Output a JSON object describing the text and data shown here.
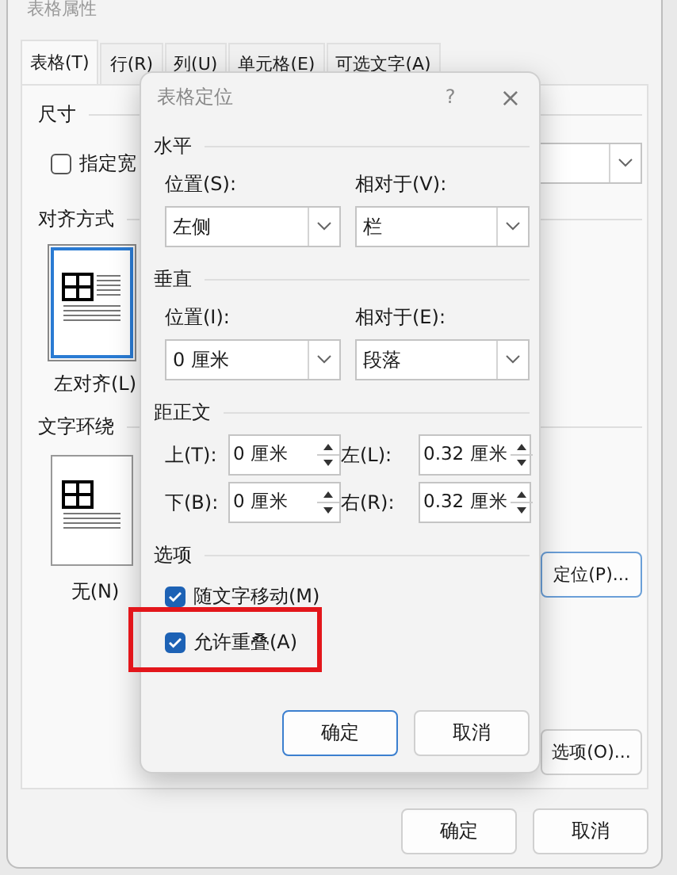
{
  "outer_dialog": {
    "title": "表格属性",
    "tabs": [
      {
        "label": "表格(T)",
        "selected": true
      },
      {
        "label": "行(R)",
        "selected": false
      },
      {
        "label": "列(U)",
        "selected": false
      },
      {
        "label": "单元格(E)",
        "selected": false
      },
      {
        "label": "可选文字(A)",
        "selected": false
      }
    ],
    "size_section": {
      "heading": "尺寸",
      "width_checkbox": {
        "label": "指定宽",
        "checked": false
      }
    },
    "alignment_section": {
      "heading": "对齐方式",
      "option": {
        "label": "左对齐(L)",
        "selected": true
      }
    },
    "wrap_section": {
      "heading": "文字环绕",
      "option": {
        "label": "无(N)",
        "selected": false
      }
    },
    "position_button": "定位(P)...",
    "options_button": "选项(O)...",
    "buttons": [
      {
        "label": "确定"
      },
      {
        "label": "取消"
      }
    ]
  },
  "inner_dialog": {
    "title": "表格定位",
    "help": "?",
    "close": "×",
    "horizontal": {
      "heading": "水平",
      "position": {
        "label": "位置(S):",
        "value": "左侧"
      },
      "relative": {
        "label": "相对于(V):",
        "value": "栏"
      }
    },
    "vertical": {
      "heading": "垂直",
      "position": {
        "label": "位置(I):",
        "value": "0 厘米"
      },
      "relative": {
        "label": "相对于(E):",
        "value": "段落"
      }
    },
    "distance": {
      "heading": "距正文",
      "fields": [
        {
          "label": "上(T):",
          "value": "0 厘米"
        },
        {
          "label": "左(L):",
          "value": "0.32 厘米"
        },
        {
          "label": "下(B):",
          "value": "0 厘米"
        },
        {
          "label": "右(R):",
          "value": "0.32 厘米"
        }
      ]
    },
    "options": {
      "heading": "选项",
      "checkboxes": [
        {
          "label": "随文字移动(M)",
          "checked": true,
          "highlighted": false
        },
        {
          "label": "允许重叠(A)",
          "checked": true,
          "highlighted": true
        }
      ]
    },
    "buttons": [
      {
        "label": "确定",
        "default": true
      },
      {
        "label": "取消",
        "default": false
      }
    ]
  }
}
